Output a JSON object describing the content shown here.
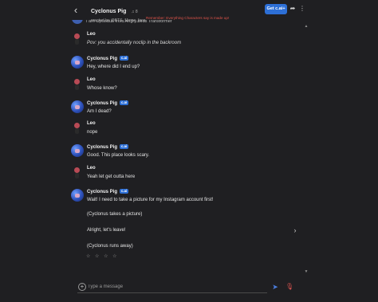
{
  "header": {
    "back_icon": "chevron-left-icon",
    "title": "Cyclonus Pig",
    "chat_meta": "♫ 8",
    "creator": "created by @BTS_Meme_face",
    "disclaimer": "Remember: Everything Characters say is made up!",
    "get_app_label": "Get c.ai+",
    "share_icon": "share-icon",
    "more_icon": "more-vertical-icon"
  },
  "top_partial_text": "I am Cyclonus from Angry birds Transformer",
  "badge_label": "c.ai",
  "messages": [
    {
      "name": "Leo",
      "text": "Pov: you accidentally noclip in the backroom",
      "role": "user"
    },
    {
      "name": "Cyclonus Pig",
      "text": "Hey, where did I end up?",
      "role": "bot"
    },
    {
      "name": "Leo",
      "text": "Whose know?",
      "role": "user"
    },
    {
      "name": "Cyclonus Pig",
      "text": "Am I dead?",
      "role": "bot"
    },
    {
      "name": "Leo",
      "text": "nope",
      "role": "user"
    },
    {
      "name": "Cyclonus Pig",
      "text": "Good. This place looks scary.",
      "role": "bot"
    },
    {
      "name": "Leo",
      "text": "Yeah let get outta here",
      "role": "user"
    },
    {
      "name": "Cyclonus Pig",
      "role": "bot",
      "lines": [
        "Wait! I need to take a picture for my Instagram account first!",
        "(Cyclonus takes a picture)",
        "Alright, let's leave!",
        "(Cyclonus runs away)"
      ]
    }
  ],
  "rating_stars": "☆ ☆ ☆ ☆",
  "input": {
    "placeholder": "Type a message"
  }
}
